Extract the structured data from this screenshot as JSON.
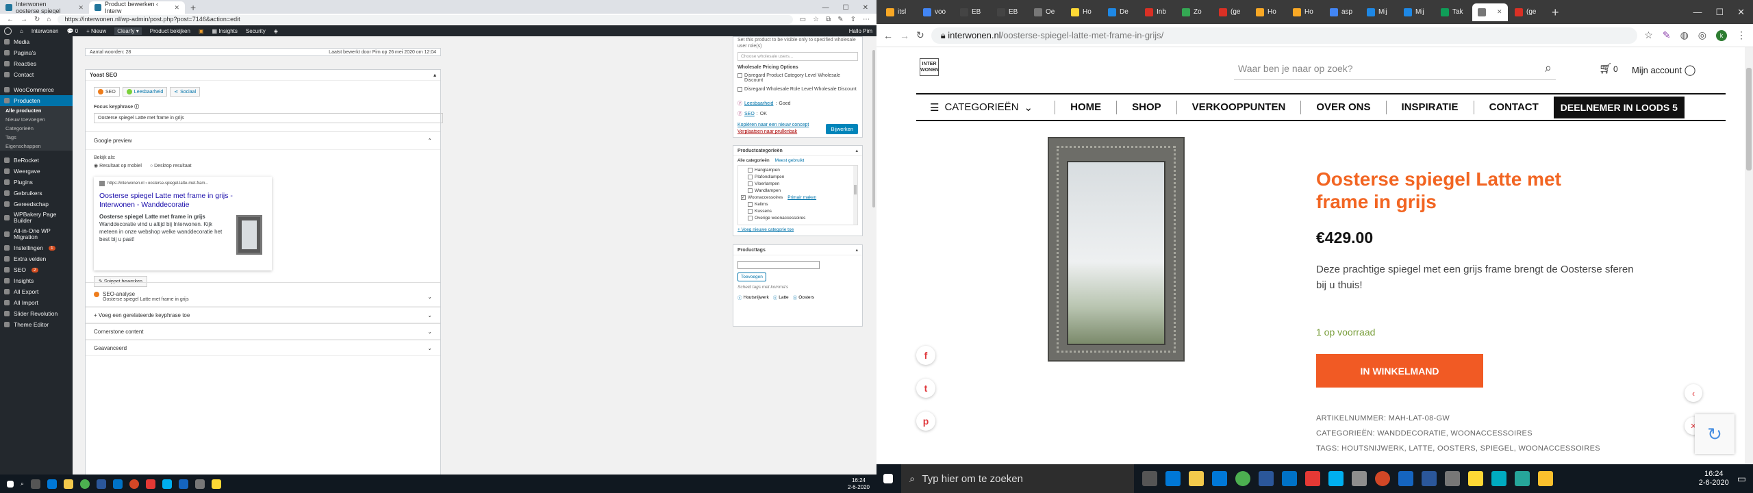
{
  "left_browser": {
    "tabs": [
      {
        "label": "Interwonen oosterse spiegel",
        "active": false
      },
      {
        "label": "Product bewerken ‹ Interw",
        "active": true
      }
    ],
    "url": "https://interwonen.nl/wp-admin/post.php?post=7146&action=edit"
  },
  "wp_adminbar": {
    "site": "Interwonen",
    "comments": "0",
    "new": "+ Nieuw",
    "clearfy": "Clearfy",
    "view_product": "Product bekijken",
    "insights": "Insights",
    "security": "Security",
    "greeting": "Hallo Pim"
  },
  "wp_sidebar": {
    "top_items": [
      "Media",
      "Pagina's",
      "Reacties",
      "Contact"
    ],
    "woocommerce": "WooCommerce",
    "products": "Producten",
    "products_sub": [
      "Alle producten",
      "Nieuw toevoegen",
      "Categorieën",
      "Tags",
      "Eigenschappen"
    ],
    "items": [
      {
        "label": "BeRocket",
        "badge": ""
      },
      {
        "label": "Weergave",
        "badge": ""
      },
      {
        "label": "Plugins",
        "badge": ""
      },
      {
        "label": "Gebruikers",
        "badge": ""
      },
      {
        "label": "Gereedschap",
        "badge": ""
      },
      {
        "label": "WPBakery Page Builder",
        "badge": ""
      },
      {
        "label": "All-in-One WP Migration",
        "badge": ""
      },
      {
        "label": "Instellingen",
        "badge": "1"
      },
      {
        "label": "Extra velden",
        "badge": ""
      },
      {
        "label": "SEO",
        "badge": "2"
      },
      {
        "label": "Insights",
        "badge": ""
      },
      {
        "label": "All Export",
        "badge": ""
      },
      {
        "label": "All Import",
        "badge": ""
      },
      {
        "label": "Slider Revolution",
        "badge": ""
      },
      {
        "label": "Theme Editor",
        "badge": ""
      }
    ]
  },
  "editor": {
    "word_count": "Aantal woorden: 28",
    "last_edited": "Laatst bewerkt door Pim op 26 mei 2020 om 12:04",
    "yoast_title": "Yoast SEO",
    "yoast_tabs": [
      "SEO",
      "Leesbaarheid",
      "Sociaal"
    ],
    "focus_label": "Focus keyphrase",
    "focus_value": "Oosterse spiegel Latte met frame in grijs",
    "google_preview": "Google preview",
    "view_as": "Bekijk als:",
    "radio_mobile": "Resultaat op mobiel",
    "radio_desktop": "Desktop resultaat",
    "snippet_url": "https://interwonen.nl › oosterse-spiegel-latte-met-fram...",
    "snippet_title": "Oosterse spiegel Latte met frame in grijs - Interwonen - Wanddecoratie",
    "snippet_desc_bold": "Oosterse spiegel Latte met frame in grijs",
    "snippet_desc": "Wanddecoratie vind u altijd bij Interwonen. Kijk meteen in onze webshop welke wanddecoratie het best bij u past!",
    "snippet_edit": "Snippet bewerken",
    "seo_analysis": "SEO-analyse",
    "seo_analysis_sub": "Oosterse spiegel Latte met frame in grijs",
    "related": "+ Voeg een gerelateerde keyphrase toe",
    "cornerstone": "Cornerstone content",
    "advanced": "Geavanceerd"
  },
  "publish_box": {
    "top_text": "Set this product to be visible only to specified wholesale user role(s)",
    "select_placeholder": "Choose wholesale users...",
    "pricing_title": "Wholesale Pricing Options",
    "opt1": "Disregard Product Category Level Wholesale Discount",
    "opt2": "Disregard Wholesale Role Level Wholesale Discount",
    "readability_label": "Leesbaarheid",
    "readability_value": "Goed",
    "seo_label": "SEO",
    "seo_value": "OK",
    "copy_link": "Kopiëren naar een nieuw concept",
    "trash_link": "Verplaatsen naar prullenbak",
    "update_button": "Bijwerken"
  },
  "categories_box": {
    "title": "Productcategorieën",
    "tab_all": "Alle categorieën",
    "tab_popular": "Meest gebruikt",
    "items": [
      {
        "label": "Hanglampen",
        "checked": false,
        "indent": 1
      },
      {
        "label": "Plafondlampen",
        "checked": false,
        "indent": 1
      },
      {
        "label": "Vloerlampen",
        "checked": false,
        "indent": 1
      },
      {
        "label": "Wandlampen",
        "checked": false,
        "indent": 1
      },
      {
        "label": "Woonaccessoires",
        "checked": true,
        "indent": 0,
        "primary": "Primair maken"
      },
      {
        "label": "Kelims",
        "checked": false,
        "indent": 1
      },
      {
        "label": "Kussens",
        "checked": false,
        "indent": 1
      },
      {
        "label": "Overige woonaccessoires",
        "checked": false,
        "indent": 1
      }
    ],
    "add_link": "+ Voeg nieuwe categorie toe"
  },
  "tags_box": {
    "title": "Producttags",
    "add_button": "Toevoegen",
    "hint": "Scheid tags met komma's",
    "tags": [
      "Houtsnijwerk",
      "Latte",
      "Oosters"
    ]
  },
  "left_taskbar": {
    "time": "16:24",
    "date": "2-6-2020"
  },
  "right_browser": {
    "tab_labels": [
      "itsl",
      "voo",
      "EB",
      "EB",
      "Oe",
      "Ho",
      "De",
      "Inb",
      "Zo",
      "(ge",
      "Ho",
      "Ho",
      "asp",
      "Mij",
      "Mij",
      "Tak",
      "",
      "(ge"
    ],
    "url_domain": "interwonen.nl",
    "url_path": "/oosterse-spiegel-latte-met-frame-in-grijs/",
    "avatar_letter": "k"
  },
  "site": {
    "logo": "INTER WONEN",
    "search_placeholder": "Waar ben je naar op zoek?",
    "cart_count": "0",
    "account": "Mijn account",
    "categories_button": "CATEGORIEËN",
    "menu": [
      "HOME",
      "SHOP",
      "VERKOOPPUNTEN",
      "OVER ONS",
      "INSPIRATIE",
      "CONTACT"
    ],
    "cta": "DEELNEMER IN LOODS 5",
    "product": {
      "title": "Oosterse spiegel Latte met frame in grijs",
      "price": "€429.00",
      "description": "Deze prachtige spiegel met een grijs frame brengt de Oosterse sferen bij u thuis!",
      "stock": "1 op voorraad",
      "add_to_cart": "IN WINKELMAND",
      "sku": "ARTIKELNUMMER: MAH-LAT-08-GW",
      "categories": "CATEGORIEËN: WANDDECORATIE, WOONACCESSOIRES",
      "tags": "TAGS: HOUTSNIJWERK, LATTE, OOSTERS, SPIEGEL, WOONACCESSOIRES"
    }
  },
  "right_taskbar": {
    "search": "Typ hier om te zoeken",
    "time": "16:24",
    "date": "2-6-2020"
  }
}
